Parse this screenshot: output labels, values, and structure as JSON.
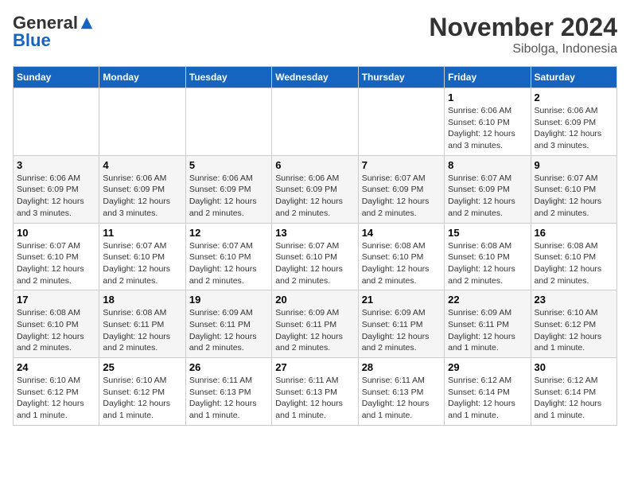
{
  "header": {
    "logo_general": "General",
    "logo_blue": "Blue",
    "month_title": "November 2024",
    "location": "Sibolga, Indonesia"
  },
  "days_of_week": [
    "Sunday",
    "Monday",
    "Tuesday",
    "Wednesday",
    "Thursday",
    "Friday",
    "Saturday"
  ],
  "weeks": [
    [
      {
        "day": "",
        "info": ""
      },
      {
        "day": "",
        "info": ""
      },
      {
        "day": "",
        "info": ""
      },
      {
        "day": "",
        "info": ""
      },
      {
        "day": "",
        "info": ""
      },
      {
        "day": "1",
        "info": "Sunrise: 6:06 AM\nSunset: 6:10 PM\nDaylight: 12 hours and 3 minutes."
      },
      {
        "day": "2",
        "info": "Sunrise: 6:06 AM\nSunset: 6:09 PM\nDaylight: 12 hours and 3 minutes."
      }
    ],
    [
      {
        "day": "3",
        "info": "Sunrise: 6:06 AM\nSunset: 6:09 PM\nDaylight: 12 hours and 3 minutes."
      },
      {
        "day": "4",
        "info": "Sunrise: 6:06 AM\nSunset: 6:09 PM\nDaylight: 12 hours and 3 minutes."
      },
      {
        "day": "5",
        "info": "Sunrise: 6:06 AM\nSunset: 6:09 PM\nDaylight: 12 hours and 2 minutes."
      },
      {
        "day": "6",
        "info": "Sunrise: 6:06 AM\nSunset: 6:09 PM\nDaylight: 12 hours and 2 minutes."
      },
      {
        "day": "7",
        "info": "Sunrise: 6:07 AM\nSunset: 6:09 PM\nDaylight: 12 hours and 2 minutes."
      },
      {
        "day": "8",
        "info": "Sunrise: 6:07 AM\nSunset: 6:09 PM\nDaylight: 12 hours and 2 minutes."
      },
      {
        "day": "9",
        "info": "Sunrise: 6:07 AM\nSunset: 6:10 PM\nDaylight: 12 hours and 2 minutes."
      }
    ],
    [
      {
        "day": "10",
        "info": "Sunrise: 6:07 AM\nSunset: 6:10 PM\nDaylight: 12 hours and 2 minutes."
      },
      {
        "day": "11",
        "info": "Sunrise: 6:07 AM\nSunset: 6:10 PM\nDaylight: 12 hours and 2 minutes."
      },
      {
        "day": "12",
        "info": "Sunrise: 6:07 AM\nSunset: 6:10 PM\nDaylight: 12 hours and 2 minutes."
      },
      {
        "day": "13",
        "info": "Sunrise: 6:07 AM\nSunset: 6:10 PM\nDaylight: 12 hours and 2 minutes."
      },
      {
        "day": "14",
        "info": "Sunrise: 6:08 AM\nSunset: 6:10 PM\nDaylight: 12 hours and 2 minutes."
      },
      {
        "day": "15",
        "info": "Sunrise: 6:08 AM\nSunset: 6:10 PM\nDaylight: 12 hours and 2 minutes."
      },
      {
        "day": "16",
        "info": "Sunrise: 6:08 AM\nSunset: 6:10 PM\nDaylight: 12 hours and 2 minutes."
      }
    ],
    [
      {
        "day": "17",
        "info": "Sunrise: 6:08 AM\nSunset: 6:10 PM\nDaylight: 12 hours and 2 minutes."
      },
      {
        "day": "18",
        "info": "Sunrise: 6:08 AM\nSunset: 6:11 PM\nDaylight: 12 hours and 2 minutes."
      },
      {
        "day": "19",
        "info": "Sunrise: 6:09 AM\nSunset: 6:11 PM\nDaylight: 12 hours and 2 minutes."
      },
      {
        "day": "20",
        "info": "Sunrise: 6:09 AM\nSunset: 6:11 PM\nDaylight: 12 hours and 2 minutes."
      },
      {
        "day": "21",
        "info": "Sunrise: 6:09 AM\nSunset: 6:11 PM\nDaylight: 12 hours and 2 minutes."
      },
      {
        "day": "22",
        "info": "Sunrise: 6:09 AM\nSunset: 6:11 PM\nDaylight: 12 hours and 1 minute."
      },
      {
        "day": "23",
        "info": "Sunrise: 6:10 AM\nSunset: 6:12 PM\nDaylight: 12 hours and 1 minute."
      }
    ],
    [
      {
        "day": "24",
        "info": "Sunrise: 6:10 AM\nSunset: 6:12 PM\nDaylight: 12 hours and 1 minute."
      },
      {
        "day": "25",
        "info": "Sunrise: 6:10 AM\nSunset: 6:12 PM\nDaylight: 12 hours and 1 minute."
      },
      {
        "day": "26",
        "info": "Sunrise: 6:11 AM\nSunset: 6:13 PM\nDaylight: 12 hours and 1 minute."
      },
      {
        "day": "27",
        "info": "Sunrise: 6:11 AM\nSunset: 6:13 PM\nDaylight: 12 hours and 1 minute."
      },
      {
        "day": "28",
        "info": "Sunrise: 6:11 AM\nSunset: 6:13 PM\nDaylight: 12 hours and 1 minute."
      },
      {
        "day": "29",
        "info": "Sunrise: 6:12 AM\nSunset: 6:14 PM\nDaylight: 12 hours and 1 minute."
      },
      {
        "day": "30",
        "info": "Sunrise: 6:12 AM\nSunset: 6:14 PM\nDaylight: 12 hours and 1 minute."
      }
    ]
  ]
}
